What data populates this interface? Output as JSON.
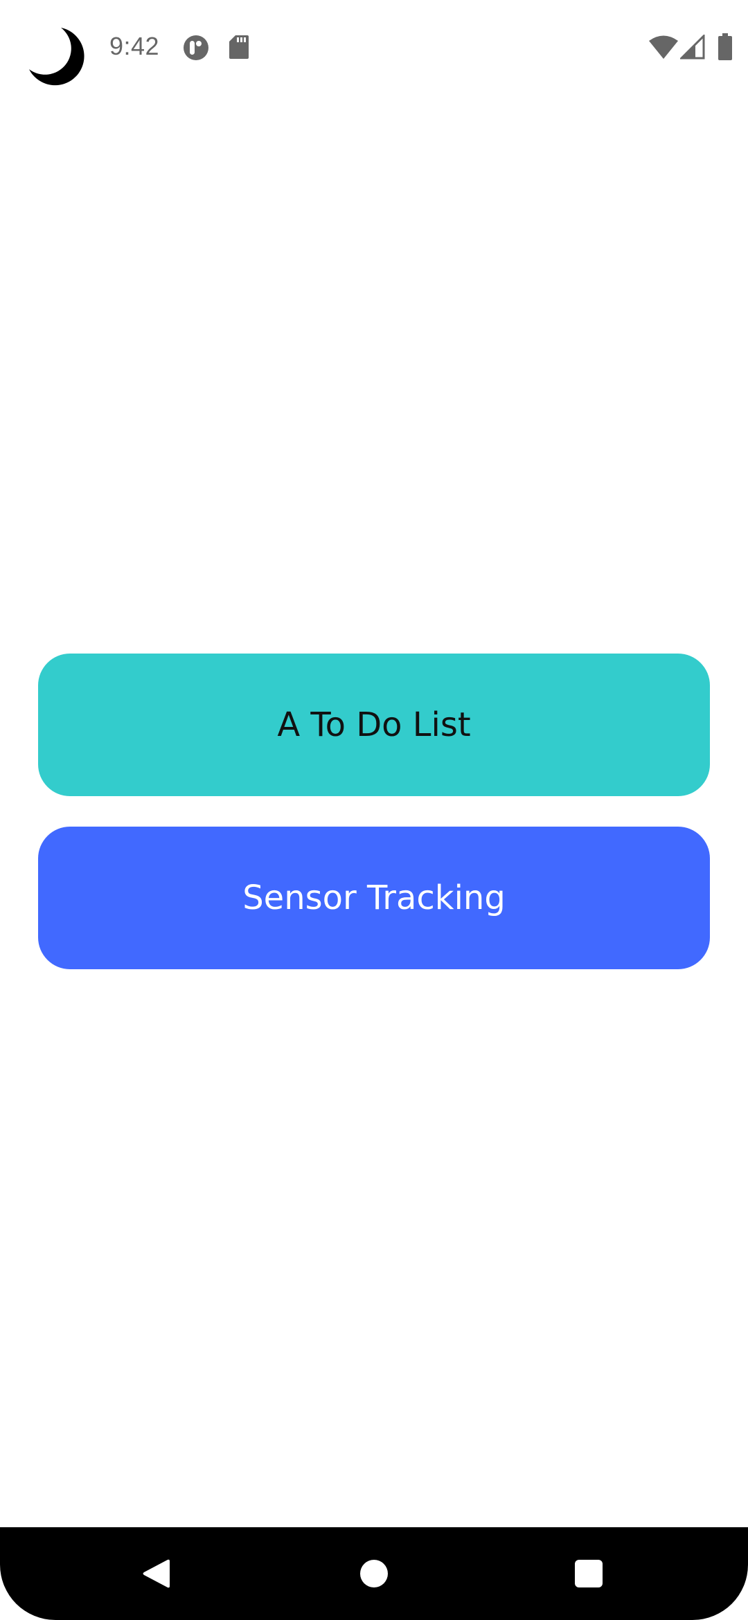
{
  "status_bar": {
    "time": "9:42",
    "icons": [
      "moon-icon",
      "notification-app-icon",
      "sd-card-icon",
      "wifi-icon",
      "cell-signal-icon",
      "battery-icon"
    ]
  },
  "main": {
    "buttons": [
      {
        "label": "A To Do List",
        "color": "#33cccc",
        "text_color": "#111111"
      },
      {
        "label": "Sensor Tracking",
        "color": "#4169ff",
        "text_color": "#ffffff"
      }
    ]
  },
  "nav_bar": {
    "icons": [
      "back-icon",
      "home-icon",
      "recents-icon"
    ]
  }
}
